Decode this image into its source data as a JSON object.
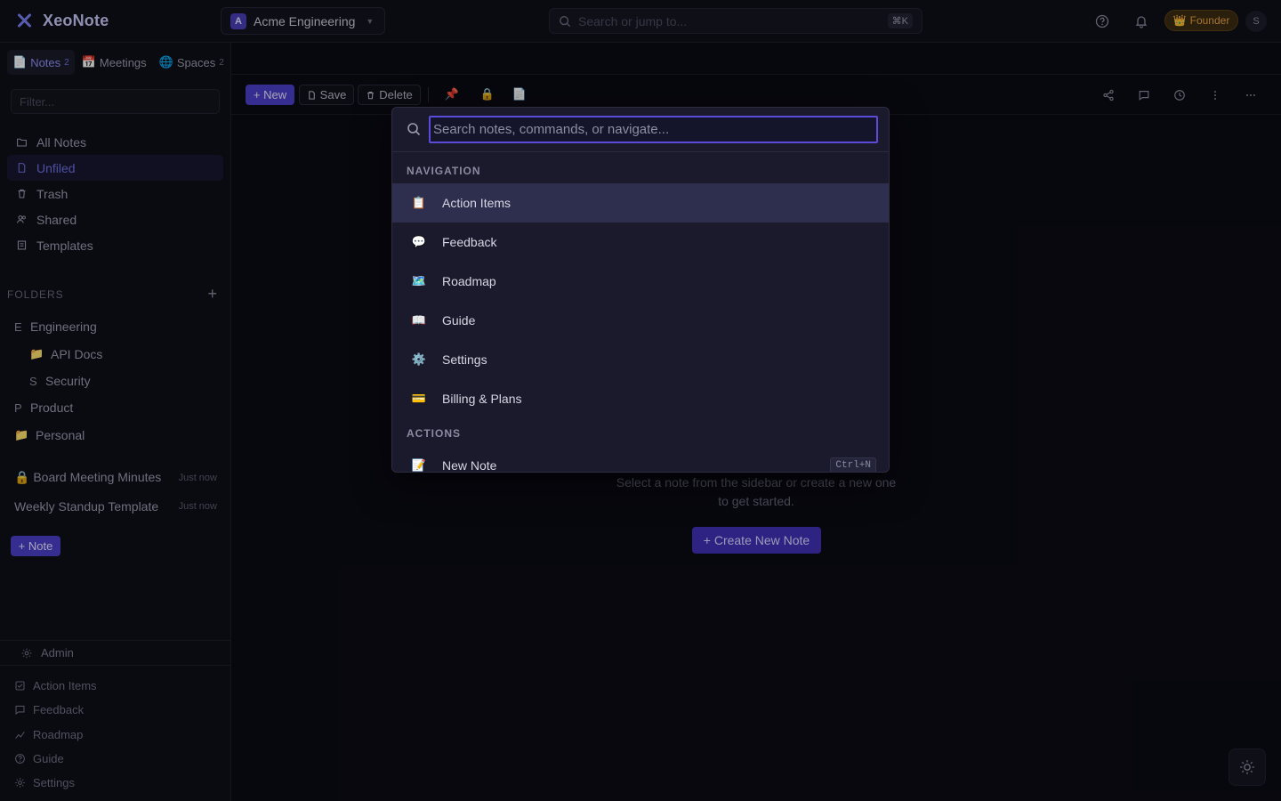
{
  "app": {
    "name": "XeoNote"
  },
  "workspace": {
    "initial": "A",
    "name": "Acme Engineering"
  },
  "topsearch": {
    "placeholder": "Search or jump to...",
    "shortcut": "⌘K"
  },
  "badge": {
    "label": "Founder",
    "icon": "crown-icon"
  },
  "user": {
    "initial": "S"
  },
  "sidebar": {
    "tabs": [
      {
        "label": "Notes",
        "count": "2",
        "icon": "📄"
      },
      {
        "label": "Meetings",
        "count": "",
        "icon": "📅"
      },
      {
        "label": "Spaces",
        "count": "2",
        "icon": "🌐"
      }
    ],
    "filter_placeholder": "Filter...",
    "nav": [
      {
        "label": "All Notes",
        "icon": "folder-icon"
      },
      {
        "label": "Unfiled",
        "icon": "file-icon"
      },
      {
        "label": "Trash",
        "icon": "trash-icon"
      },
      {
        "label": "Shared",
        "icon": "users-icon"
      },
      {
        "label": "Templates",
        "icon": "template-icon"
      }
    ],
    "folders_title": "FOLDERS",
    "folders_add": "+",
    "folders": [
      {
        "initial": "E",
        "label": "Engineering"
      },
      {
        "initial": "📁",
        "label": "API Docs"
      },
      {
        "initial": "S",
        "label": "Security"
      },
      {
        "initial": "P",
        "label": "Product"
      },
      {
        "initial": "📁",
        "label": "Personal"
      }
    ],
    "recent": [
      {
        "title": "🔒 Board Meeting Minutes",
        "time": "Just now"
      },
      {
        "title": "Weekly Standup Template",
        "time": "Just now"
      }
    ],
    "new_note": "+ Note",
    "admin": "Admin",
    "bottom_nav": [
      {
        "label": "Action Items",
        "icon": "checkbox-icon"
      },
      {
        "label": "Feedback",
        "icon": "message-icon"
      },
      {
        "label": "Roadmap",
        "icon": "trend-icon"
      },
      {
        "label": "Guide",
        "icon": "help-icon"
      },
      {
        "label": "Settings",
        "icon": "gear-icon"
      }
    ]
  },
  "toolbar": {
    "new": "+ New",
    "save": "Save",
    "delete": "Delete",
    "pin": "📌",
    "lock": "🔒",
    "doc": "📄"
  },
  "empty": {
    "text": "Select a note from the sidebar or create a new one to get started.",
    "create": "+ Create New Note"
  },
  "palette": {
    "placeholder": "Search notes, commands, or navigate...",
    "navigation_title": "NAVIGATION",
    "actions_title": "ACTIONS",
    "navigation": [
      {
        "emoji": "📋",
        "label": "Action Items"
      },
      {
        "emoji": "💬",
        "label": "Feedback"
      },
      {
        "emoji": "🗺️",
        "label": "Roadmap"
      },
      {
        "emoji": "📖",
        "label": "Guide"
      },
      {
        "emoji": "⚙️",
        "label": "Settings"
      },
      {
        "emoji": "💳",
        "label": "Billing & Plans"
      }
    ],
    "actions": [
      {
        "emoji": "📝",
        "label": "New Note",
        "shortcut": "Ctrl+N"
      }
    ]
  },
  "colors": {
    "accent": "#4c3fc8",
    "background": "#0b0b14",
    "badge": "#e6a43a"
  }
}
